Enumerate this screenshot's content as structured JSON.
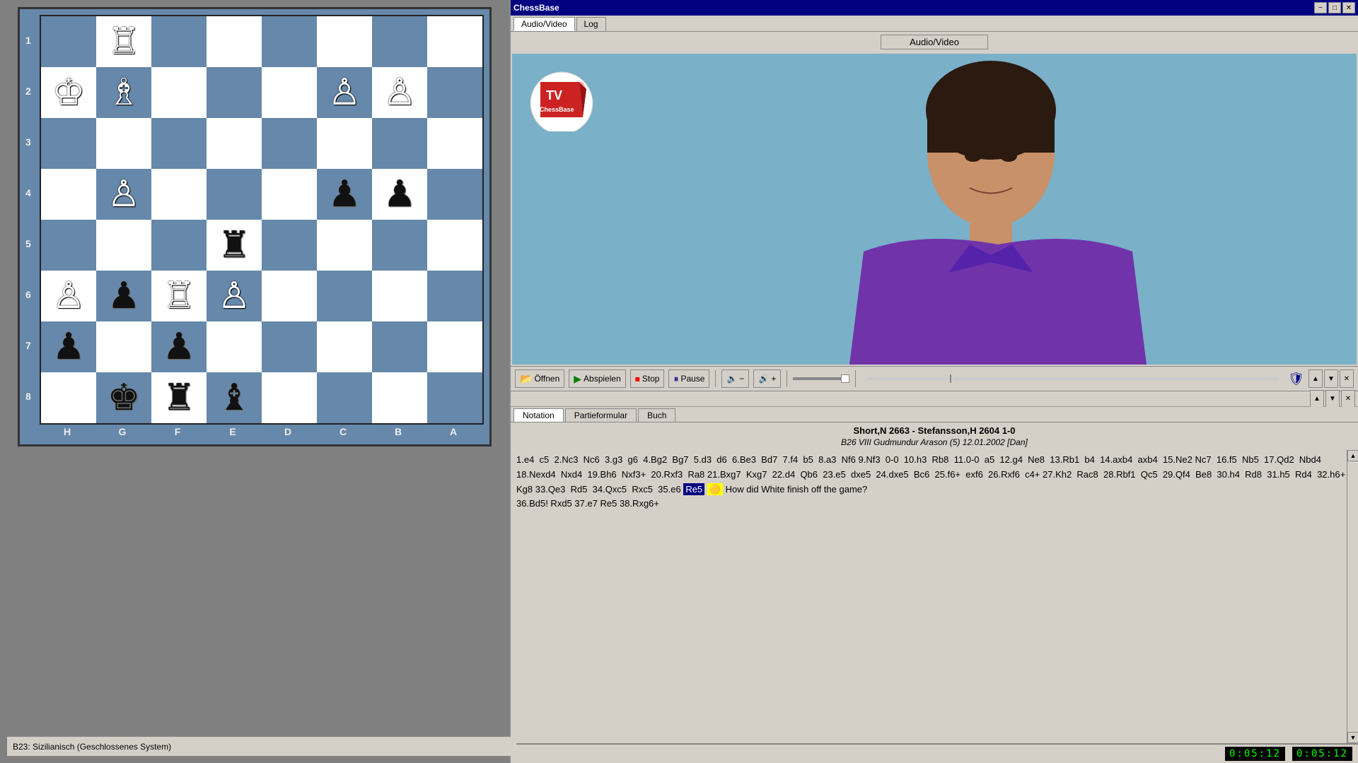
{
  "window": {
    "title": "ChessBase",
    "minimize_label": "−",
    "maximize_label": "□",
    "close_label": "✕"
  },
  "top_tabs": [
    {
      "label": "Audio/Video",
      "active": true
    },
    {
      "label": "Log",
      "active": false
    }
  ],
  "av_label": "Audio/Video",
  "controls": {
    "open_label": "Öffnen",
    "play_label": "Abspielen",
    "stop_label": "Stop",
    "pause_label": "Pause",
    "vol_down": "−",
    "vol_up": "+"
  },
  "notation_tabs": [
    {
      "label": "Notation",
      "active": true
    },
    {
      "label": "Partieformular",
      "active": false
    },
    {
      "label": "Buch",
      "active": false
    }
  ],
  "game_info": {
    "players": "Short,N 2663 - Stefansson,H 2604  1-0",
    "opening": "B26 VIII Gudmundur Arason (5) 12.01.2002 [Dan]"
  },
  "moves_text": "1.e4  c5  2.Nc3  Nc6  3.g3  g6  4.Bg2  Bg7  5.d3  d6  6.Be3  Bd7  7.f4  b5  8.a3  Nf6 9.Nf3  0-0  10.h3  Rb8  11.0-0  a5  12.g4  Ne8  13.Rb1  b4  14.axb4  axb4  15.Ne2 Nc7  16.f5  Nb5  17.Qd2  Nbd4  18.Nexd4  Nxd4  19.Bh6  Nxf3+  20.Rxf3  Ra8 21.Bxg7  Kxg7  22.d4  Qb6  23.e5  dxe5  24.dxe5  Bc6  25.f6+  exf6  26.Rxf6  c4+ 27.Kh2  Rac8  28.Rbf1  Qc5  29.Qf4  Be8  30.h4  Rd8  31.h5  Rd4  32.h6+  Kg8 33.Qe3  Rd5  34.Qxc5  Rxc5  35.e6",
  "highlight_move": "Re5",
  "question_text": "How did White finish off the game?",
  "remaining_moves": "36.Bd5!  Rxd5  37.e7  Re5  38.Rxg6+",
  "status_bar": {
    "opening": "B23: Sizilianisch (Geschlossenes System)",
    "time1": "0:05:12",
    "time2": "0:05:12"
  },
  "board": {
    "files": [
      "H",
      "G",
      "F",
      "E",
      "D",
      "C",
      "B",
      "A"
    ],
    "ranks": [
      "1",
      "2",
      "3",
      "4",
      "5",
      "6",
      "7",
      "8"
    ],
    "pieces": {
      "a1": null,
      "b1": null,
      "c1": null,
      "d1": null,
      "e1": null,
      "f1": null,
      "g1": null,
      "h1": null,
      "a2": null,
      "b2": null,
      "c2": null,
      "d2": null,
      "e2": null,
      "f2": null,
      "g2": null,
      "h2": null,
      "a3": null,
      "b3": null,
      "c3": null,
      "d3": null,
      "e3": null,
      "f3": null,
      "g3": null,
      "h3": null,
      "a4": null,
      "b4": null,
      "c4": null,
      "d4": null,
      "e4": null,
      "f4": null,
      "g4": null,
      "h4": null,
      "a5": null,
      "b5": null,
      "c5": null,
      "d5": null,
      "e5": null,
      "f5": null,
      "g5": null,
      "h5": null,
      "a6": null,
      "b6": null,
      "c6": null,
      "d6": null,
      "e6": null,
      "f6": null,
      "g6": null,
      "h6": null,
      "a7": null,
      "b7": null,
      "c7": null,
      "d7": null,
      "e7": null,
      "f7": null,
      "g7": null,
      "h7": null,
      "a8": null,
      "b8": null,
      "c8": null,
      "d8": null,
      "e8": null,
      "f8": null,
      "g8": null,
      "h8": null
    }
  },
  "icons": {
    "open": "📂",
    "play": "▶",
    "stop": "⏹",
    "pause": "⏸",
    "vol_down": "🔉",
    "vol_up": "🔊",
    "scroll_up": "▲",
    "scroll_down": "▼",
    "scroll_left": "◄",
    "scroll_right": "►"
  }
}
